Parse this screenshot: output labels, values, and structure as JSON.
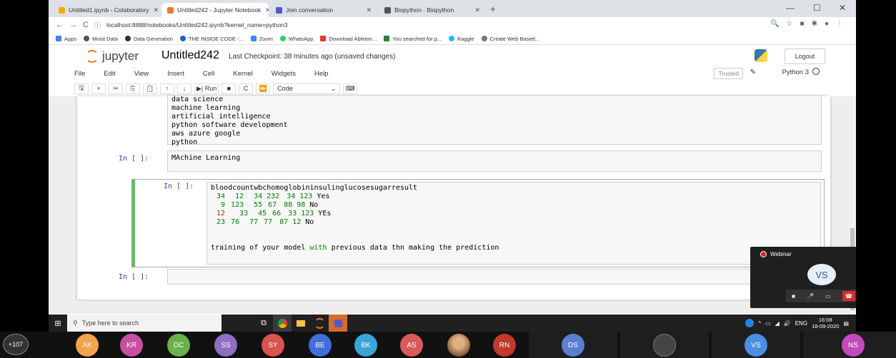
{
  "browser": {
    "tabs": [
      {
        "label": "Untitled1.ipynb - Colaboratory",
        "color": "#f9ab00",
        "active": false
      },
      {
        "label": "Untitled242 - Jupyter Notebook",
        "color": "#f37726",
        "active": true
      },
      {
        "label": "Join conversation",
        "color": "#5059c9",
        "active": false
      },
      {
        "label": "Biopython · Biopython",
        "color": "#555555",
        "active": false
      }
    ],
    "url": "localhost:8888/notebooks/Untitled242.ipynb?kernel_name=python3",
    "bookmarks": [
      {
        "label": "Apps",
        "color": "#4285f4"
      },
      {
        "label": "Mnist Data",
        "color": "#555555"
      },
      {
        "label": "Data Generation",
        "color": "#333333"
      },
      {
        "label": "THE INSIDE CODE -...",
        "color": "#1565c0"
      },
      {
        "label": "Zoom",
        "color": "#2d8cff"
      },
      {
        "label": "WhatsApp",
        "color": "#25d366"
      },
      {
        "label": "Download Ableton...",
        "color": "#e53935"
      },
      {
        "label": "You searched for p...",
        "color": "#2e7d32"
      },
      {
        "label": "Kaggle",
        "color": "#20beff"
      },
      {
        "label": "Create Web Based...",
        "color": "#777777"
      }
    ]
  },
  "jupyter": {
    "logo_text": "jupyter",
    "notebook_title": "Untitled242",
    "checkpoint": "Last Checkpoint: 38 minutes ago  (unsaved changes)",
    "logout_label": "Logout",
    "menu": [
      "File",
      "Edit",
      "View",
      "Insert",
      "Cell",
      "Kernel",
      "Widgets",
      "Help"
    ],
    "trusted_label": "Trusted",
    "kernel_name": "Python 3",
    "toolbar": {
      "run_label": "Run",
      "cell_type": "Code"
    }
  },
  "cells": {
    "cell1_lines": [
      "data science",
      "machine learning",
      "artificial intelligence",
      "python software development",
      "aws azure google",
      "python"
    ],
    "cell2_prompt": "In [ ]:",
    "cell2_text": "MAchine Learning",
    "cell3_prompt": "In [ ]:",
    "cell3_headers": [
      "bloodcount",
      "wbc",
      "homoglobin",
      "insulin",
      "glucose",
      "sugar",
      "result"
    ],
    "cell3_rows": [
      [
        "34",
        "12",
        "34",
        "232",
        "34",
        "123",
        "Yes"
      ],
      [
        "9",
        "123",
        "55",
        "67",
        "88",
        "98",
        "No"
      ],
      [
        "12",
        "33",
        "45",
        "66",
        "33",
        "123",
        "YEs"
      ],
      [
        "23",
        "76",
        "77",
        "77",
        "87",
        "12",
        "No"
      ]
    ],
    "cell3_note_before": "training of your model ",
    "cell3_note_keyword": "with",
    "cell3_note_after": " previous data thn making the prediction",
    "cell4_prompt": "In [ ]:"
  },
  "taskbar": {
    "search_placeholder": "Type here to search",
    "lang": "ENG",
    "time": "16:08",
    "date": "18-09-2020"
  },
  "webinar": {
    "title": "Webinar",
    "avatar": "VS",
    "accent": "#d32f2f"
  },
  "participants": {
    "more_count": "+107",
    "people": [
      {
        "initials": "AK",
        "color": "#f4a24d"
      },
      {
        "initials": "KR",
        "color": "#c850a0"
      },
      {
        "initials": "DC",
        "color": "#6ab04c"
      },
      {
        "initials": "SS",
        "color": "#8e6fc4"
      },
      {
        "initials": "SY",
        "color": "#d9534f"
      },
      {
        "initials": "BE",
        "color": "#3f6fd8"
      },
      {
        "initials": "BK",
        "color": "#3aa6d8"
      },
      {
        "initials": "AS",
        "color": "#d95b5b"
      },
      {
        "initials": "",
        "color": "#b07a4f"
      },
      {
        "initials": "RN",
        "color": "#c0392b"
      },
      {
        "initials": "DS",
        "color": "#5b7fd1"
      },
      {
        "initials": "",
        "color": "#555555"
      },
      {
        "initials": "VS",
        "color": "#4c8fe0"
      },
      {
        "initials": "NS",
        "color": "#c14bbd"
      }
    ]
  }
}
